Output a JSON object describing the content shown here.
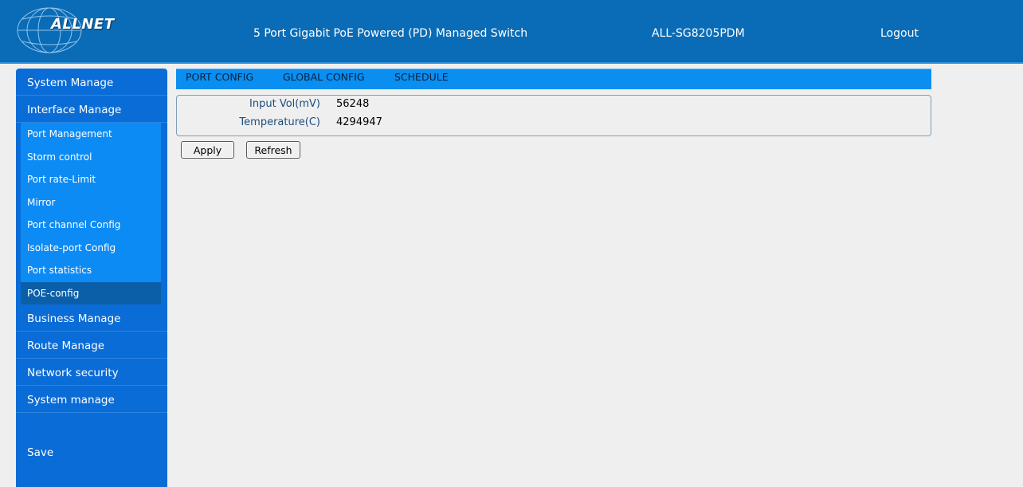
{
  "header": {
    "logo_text": "ALLNET",
    "title": "5 Port Gigabit PoE Powered (PD) Managed Switch",
    "model": "ALL-SG8205PDM",
    "logout_label": "Logout"
  },
  "sidebar": {
    "items": [
      {
        "label": "System Manage"
      },
      {
        "label": "Interface Manage"
      }
    ],
    "subitems": [
      {
        "label": "Port Management"
      },
      {
        "label": "Storm control"
      },
      {
        "label": "Port rate-Limit"
      },
      {
        "label": "Mirror"
      },
      {
        "label": "Port channel Config"
      },
      {
        "label": "Isolate-port Config"
      },
      {
        "label": "Port statistics"
      },
      {
        "label": "POE-config"
      }
    ],
    "items_after": [
      {
        "label": "Business Manage"
      },
      {
        "label": "Route Manage"
      },
      {
        "label": "Network security"
      },
      {
        "label": "System manage"
      }
    ],
    "save_label": "Save"
  },
  "tabs": [
    {
      "label": "PORT CONFIG"
    },
    {
      "label": "GLOBAL CONFIG"
    },
    {
      "label": "SCHEDULE"
    }
  ],
  "poe": {
    "input_vol_label": "Input Vol(mV)",
    "input_vol_value": "56248",
    "temperature_label": "Temperature(C)",
    "temperature_value": "4294947"
  },
  "buttons": {
    "apply_label": "Apply",
    "refresh_label": "Refresh"
  },
  "colors": {
    "header_bg": "#0a6cb6",
    "sidebar_bg": "#0a6cd6",
    "submenu_bg": "#0d8bf5",
    "active_bg": "#0b5fa8",
    "tabbar_bg": "#0a8ef0",
    "page_bg": "#efefef"
  }
}
